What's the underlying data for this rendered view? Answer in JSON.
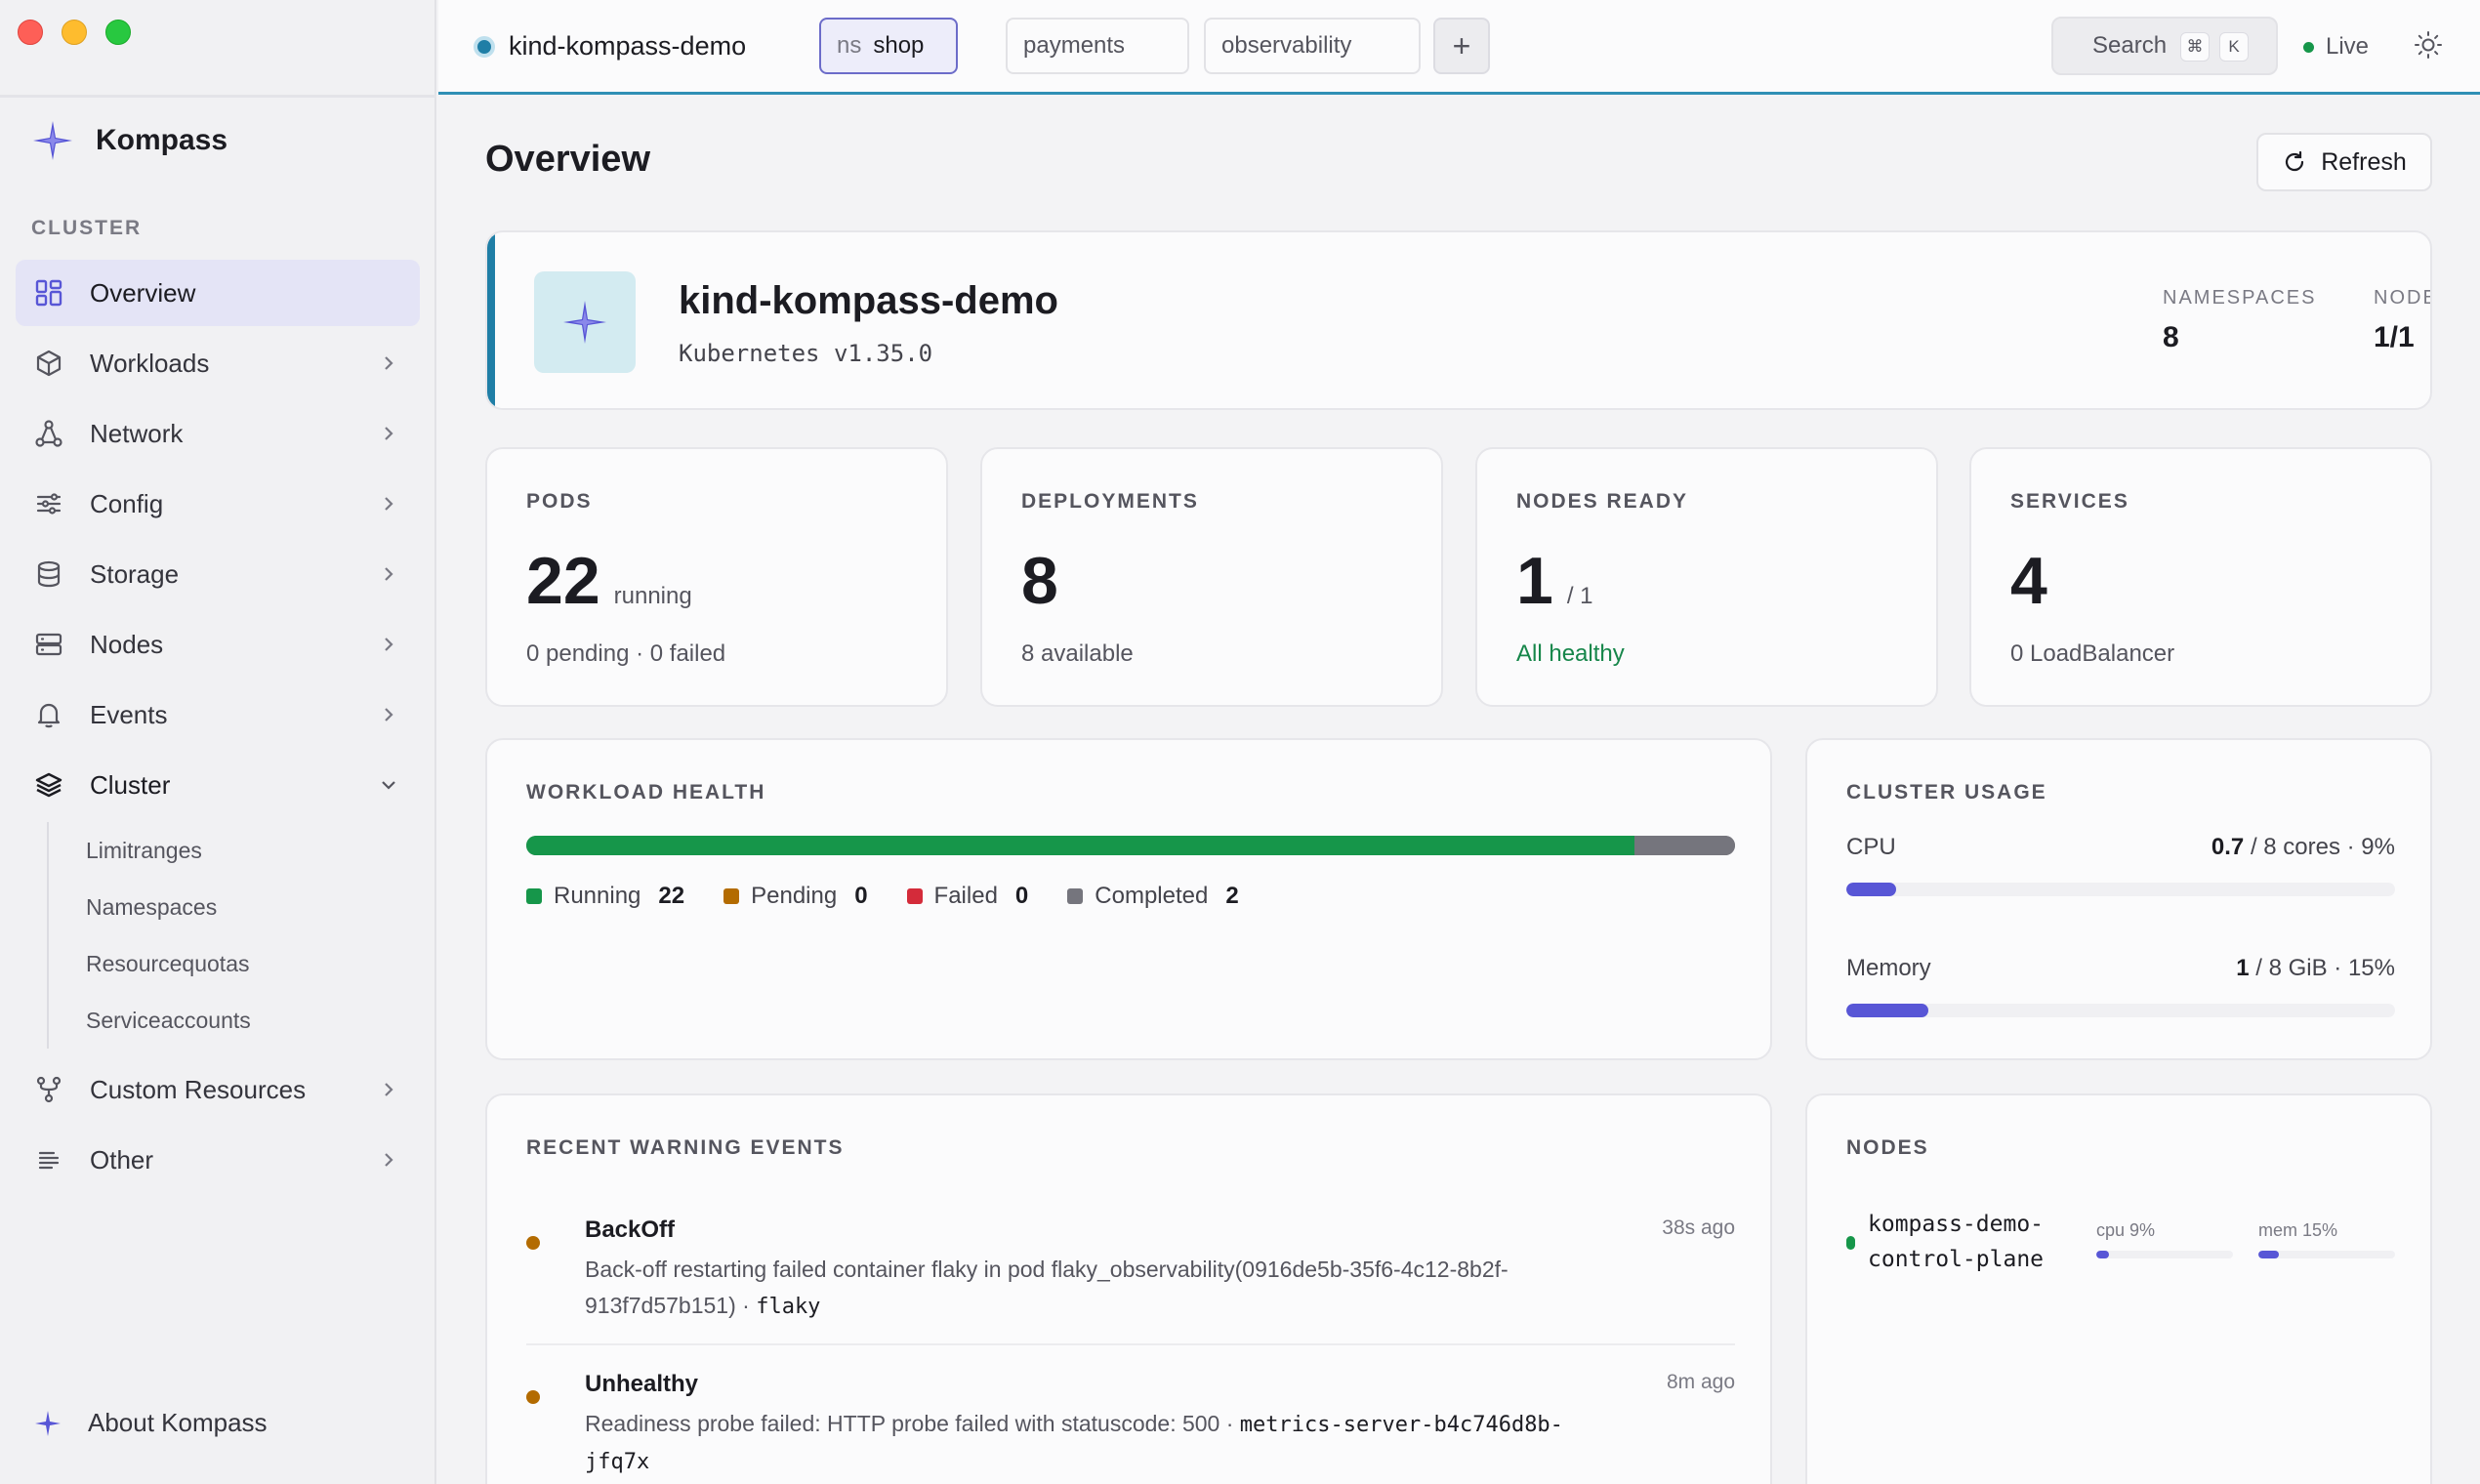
{
  "app": {
    "name": "Kompass",
    "about_label": "About Kompass"
  },
  "colors": {
    "accent": "#5856d6",
    "cluster": "#1f7ea6",
    "running": "#16964a",
    "pending": "#b36b00",
    "failed": "#d42b3a",
    "completed": "#75757d"
  },
  "sidebar": {
    "section": "CLUSTER",
    "items": [
      {
        "label": "Overview",
        "icon": "grid-icon",
        "active": true
      },
      {
        "label": "Workloads",
        "icon": "cube-icon"
      },
      {
        "label": "Network",
        "icon": "network-icon"
      },
      {
        "label": "Config",
        "icon": "sliders-icon"
      },
      {
        "label": "Storage",
        "icon": "database-icon"
      },
      {
        "label": "Nodes",
        "icon": "server-icon"
      },
      {
        "label": "Events",
        "icon": "bell-icon"
      },
      {
        "label": "Cluster",
        "icon": "layers-icon",
        "expanded": true
      }
    ],
    "cluster_children": [
      "Limitranges",
      "Namespaces",
      "Resourcequotas",
      "Serviceaccounts"
    ],
    "extra_items": [
      {
        "label": "Custom Resources",
        "icon": "fork-icon"
      },
      {
        "label": "Other",
        "icon": "lines-icon"
      }
    ]
  },
  "topbar": {
    "cluster": "kind-kompass-demo",
    "ns_prefix": "ns",
    "tabs": [
      "shop",
      "payments",
      "observability"
    ],
    "add_label": "+",
    "search_label": "Search",
    "search_keys": [
      "⌘",
      "K"
    ],
    "live_label": "Live"
  },
  "page": {
    "title": "Overview",
    "refresh_label": "Refresh"
  },
  "cluster_card": {
    "name": "kind-kompass-demo",
    "version": "Kubernetes v1.35.0",
    "namespaces_label": "NAMESPACES",
    "namespaces": "8",
    "nodes_label": "NODES",
    "nodes": "1/1"
  },
  "stats": [
    {
      "label": "PODS",
      "value": "22",
      "suffix": "running",
      "foot": "0 pending · 0 failed"
    },
    {
      "label": "DEPLOYMENTS",
      "value": "8",
      "suffix": "",
      "foot": "8 available"
    },
    {
      "label": "NODES READY",
      "value": "1",
      "suffix": "/ 1",
      "foot": "All healthy"
    },
    {
      "label": "SERVICES",
      "value": "4",
      "suffix": "",
      "foot": "0 LoadBalancer"
    }
  ],
  "health": {
    "title": "WORKLOAD HEALTH",
    "items": [
      {
        "label": "Running",
        "count": 22
      },
      {
        "label": "Pending",
        "count": 0
      },
      {
        "label": "Failed",
        "count": 0
      },
      {
        "label": "Completed",
        "count": 2
      }
    ]
  },
  "usage": {
    "title": "CLUSTER USAGE",
    "cpu": {
      "label": "CPU",
      "used": "0.7",
      "rest": "/ 8 cores · 9%",
      "percent": 9
    },
    "memory": {
      "label": "Memory",
      "used": "1",
      "rest": "/ 8 GiB · 15%",
      "percent": 15
    }
  },
  "events": {
    "title": "RECENT WARNING EVENTS",
    "items": [
      {
        "reason": "BackOff",
        "ago": "38s ago",
        "message": "Back-off restarting failed container flaky in pod flaky_observability(0916de5b-35f6-4c12-8b2f-913f7d57b151) · ",
        "object": "flaky"
      },
      {
        "reason": "Unhealthy",
        "ago": "8m ago",
        "message": "Readiness probe failed: HTTP probe failed with statuscode: 500 · ",
        "object": "metrics-server-b4c746d8b-jfq7x"
      }
    ]
  },
  "nodes_card": {
    "title": "NODES",
    "items": [
      {
        "name": "kompass-demo-control-plane",
        "cpu_label": "cpu 9%",
        "cpu": 9,
        "mem_label": "mem 15%",
        "mem": 15
      }
    ]
  }
}
